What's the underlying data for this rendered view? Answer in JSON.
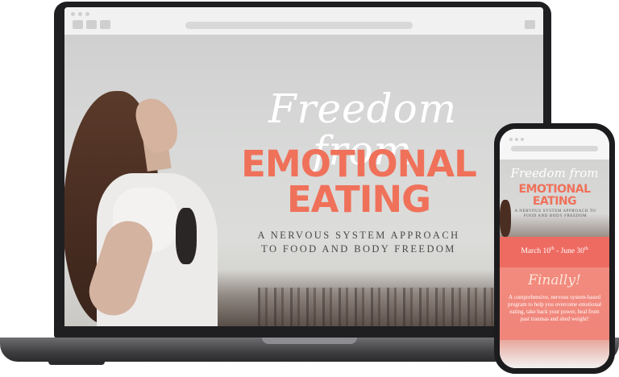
{
  "laptop": {
    "hero": {
      "script_title": "Freedom from",
      "big_line_1": "EMOTIONAL",
      "big_line_2": "EATING",
      "subtitle_line_1": "A NERVOUS SYSTEM APPROACH",
      "subtitle_line_2": "TO FOOD AND BODY FREEDOM"
    }
  },
  "phone": {
    "hero": {
      "script_title": "Freedom from",
      "big_line_1": "EMOTIONAL",
      "big_line_2": "EATING",
      "subtitle": "A NERVOUS SYSTEM APPROACH TO FOOD AND BODY FREEDOM"
    },
    "dates": {
      "start": "March 10",
      "start_suffix": "th",
      "separator": " - ",
      "end": "June 30",
      "end_suffix": "th"
    },
    "finally": "Finally!",
    "description": "A comprehensive, nervous system-based program to help you overcome emotional eating, take back your power, heal from past traumas and shed weight!"
  },
  "colors": {
    "accent_coral": "#f0715a",
    "band_red": "#ee6b62",
    "device_dark": "#1f1f21"
  }
}
